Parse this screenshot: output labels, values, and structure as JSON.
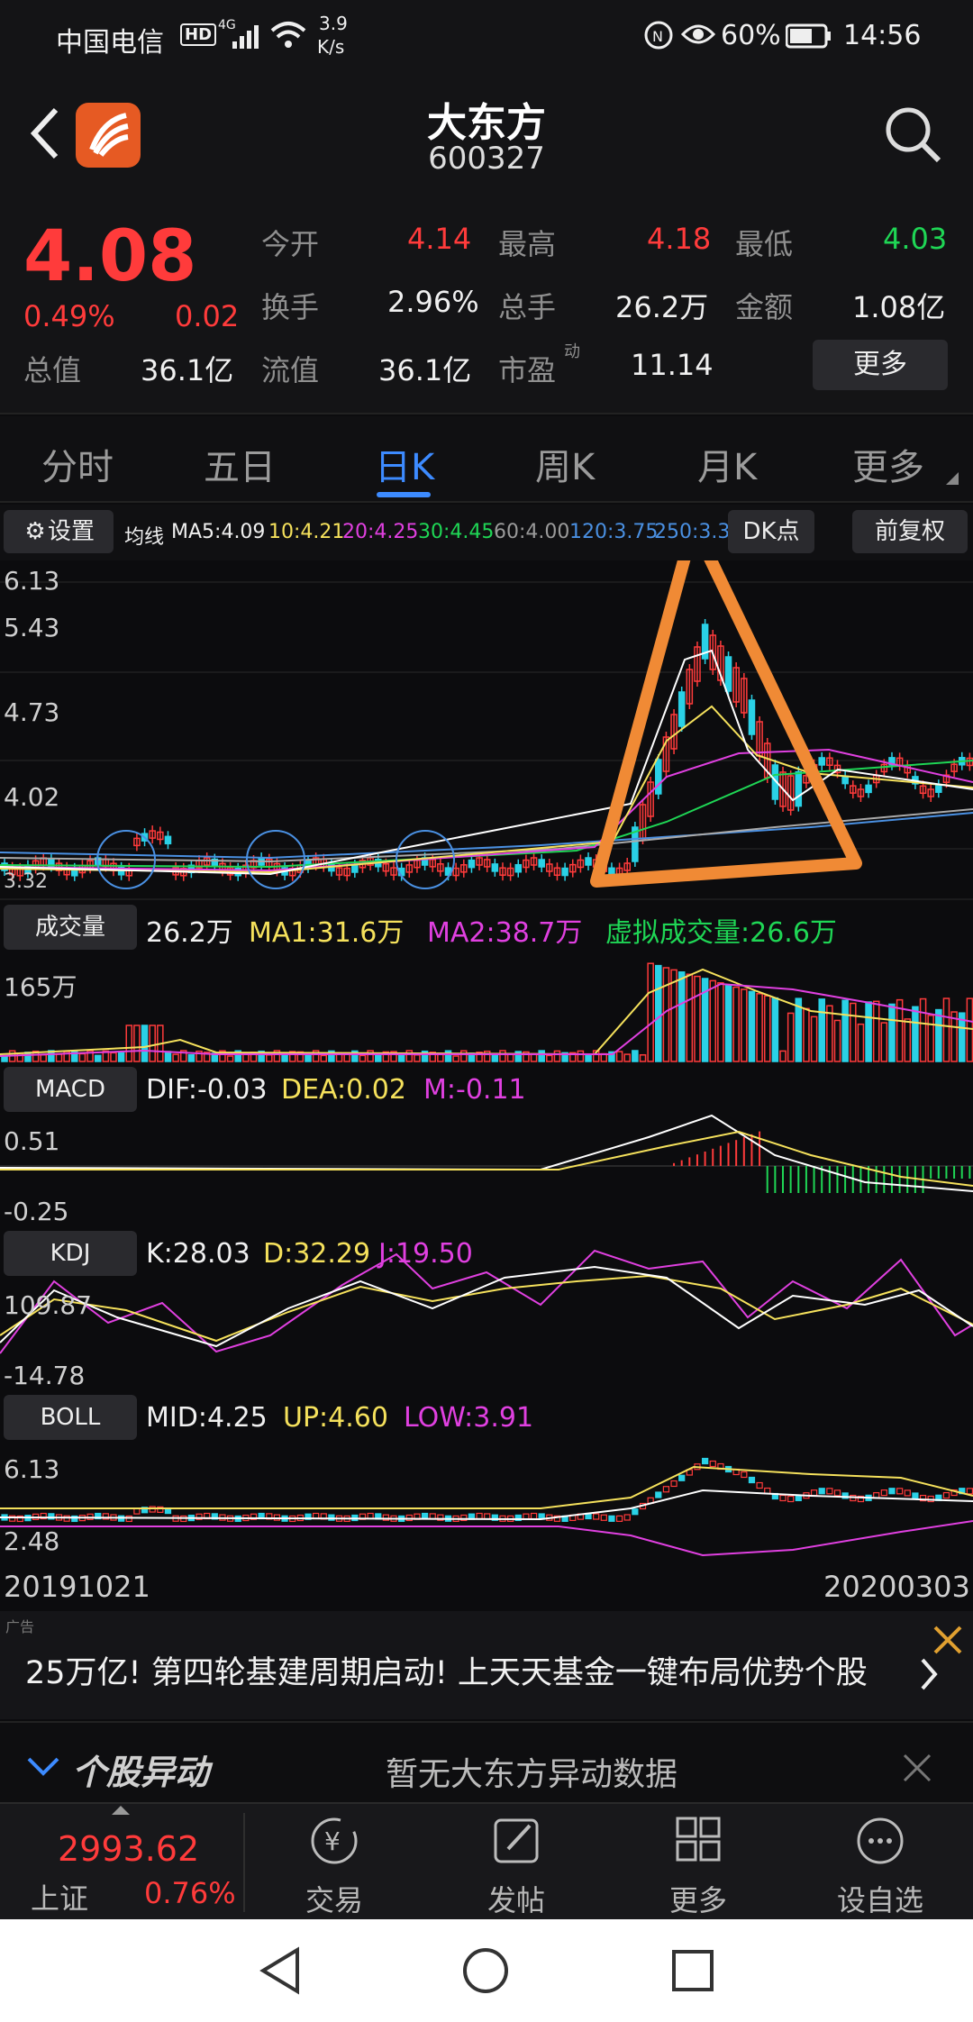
{
  "status_bar": {
    "carrier": "中国电信",
    "hd": "HD",
    "net_type": "4G",
    "speed_value": "3.9",
    "speed_unit": "K/s",
    "battery": "60%",
    "time": "14:56"
  },
  "header": {
    "title": "大东方",
    "code": "600327"
  },
  "quote": {
    "price": "4.08",
    "change_pct": "0.49%",
    "change_amt": "0.02",
    "total_value_label": "总值",
    "total_value": "36.1亿",
    "open_label": "今开",
    "open": "4.14",
    "high_label": "最高",
    "high": "4.18",
    "low_label": "最低",
    "low": "4.03",
    "turnover_label": "换手",
    "turnover": "2.96%",
    "volume_label": "总手",
    "volume": "26.2万",
    "amount_label": "金额",
    "amount": "1.08亿",
    "float_label": "流值",
    "float_value": "36.1亿",
    "pe_label": "市盈",
    "pe_sup": "动",
    "pe": "11.14",
    "more": "更多"
  },
  "tabs": [
    {
      "label": "分时"
    },
    {
      "label": "五日"
    },
    {
      "label": "日K",
      "active": true
    },
    {
      "label": "周K"
    },
    {
      "label": "月K"
    },
    {
      "label": "更多"
    }
  ],
  "ma_bar": {
    "settings": "设置",
    "prefix": "均线",
    "ma5": "MA5:4.09",
    "ma10": "10:4.21",
    "ma20": "20:4.25",
    "ma30": "30:4.45",
    "ma60": "60:4.00",
    "ma120": "120:3.75",
    "ma250": "250:3.30",
    "dk": "DK点",
    "adjust": "前复权",
    "colors": {
      "ma5": "#ffffff",
      "ma10": "#f5e15c",
      "ma20": "#e040e0",
      "ma30": "#1fd655",
      "ma60": "#aaaaaa",
      "ma120": "#4a90e2",
      "ma250": "#4a90e2"
    }
  },
  "kline": {
    "y_labels": [
      "6.13",
      "5.43",
      "4.73",
      "4.02",
      "3.32"
    ]
  },
  "volume_panel": {
    "chip": "成交量",
    "value": "26.2万",
    "ma1": "MA1:31.6万",
    "ma2": "MA2:38.7万",
    "virtual": "虚拟成交量:26.6万",
    "y_max": "165万"
  },
  "macd_panel": {
    "chip": "MACD",
    "dif": "DIF:-0.03",
    "dea": "DEA:0.02",
    "m": "M:-0.11",
    "y_max": "0.51",
    "y_min": "-0.25"
  },
  "kdj_panel": {
    "chip": "KDJ",
    "k": "K:28.03",
    "d": "D:32.29",
    "j": "J:19.50",
    "y_max": "109.87",
    "y_min": "-14.78"
  },
  "boll_panel": {
    "chip": "BOLL",
    "mid": "MID:4.25",
    "up": "UP:4.60",
    "low": "LOW:3.91",
    "y_max": "6.13",
    "y_min": "2.48"
  },
  "dates": {
    "start": "20191021",
    "end": "20200303"
  },
  "ad": {
    "tag": "广告",
    "text": "25万亿! 第四轮基建周期启动! 上天天基金一键布局优势个股"
  },
  "anomaly": {
    "title": "个股异动",
    "text": "暂无大东方异动数据"
  },
  "bottom_nav": {
    "index_value": "2993.62",
    "index_name": "上证",
    "index_change": "0.76%",
    "items": [
      {
        "label": "交易"
      },
      {
        "label": "发帖"
      },
      {
        "label": "更多"
      },
      {
        "label": "设自选"
      }
    ]
  }
}
